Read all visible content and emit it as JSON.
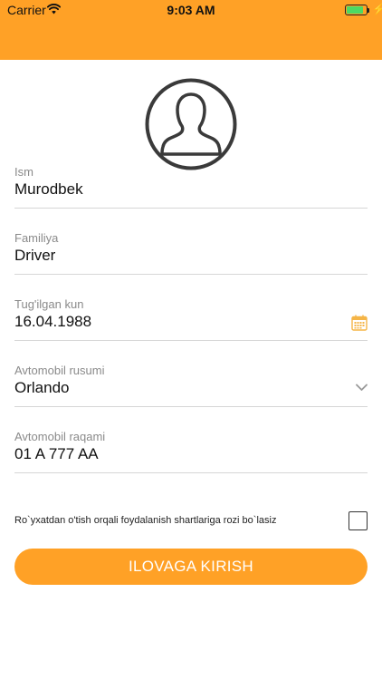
{
  "status_bar": {
    "carrier": "Carrier",
    "time": "9:03 AM",
    "battery_level": 0.9,
    "color": "#FFA126"
  },
  "avatar": {
    "icon": "user-silhouette-icon"
  },
  "form": {
    "first_name": {
      "label": "Ism",
      "value": "Murodbek"
    },
    "last_name": {
      "label": "Familiya",
      "value": "Driver"
    },
    "birth_date": {
      "label": "Tug'ilgan kun",
      "value": "16.04.1988",
      "icon": "calendar-icon"
    },
    "car_model": {
      "label": "Avtomobil rusumi",
      "value": "Orlando",
      "icon": "chevron-down-icon"
    },
    "car_number": {
      "label": "Avtomobil raqami",
      "value": "01 A 777 AA"
    }
  },
  "terms": {
    "text": "Ro`yxatdan o'tish orqali foydalanish shartlariga rozi bo`lasiz",
    "checked": false
  },
  "login_button": {
    "label": "ILOVAGA KIRISH",
    "color": "#FFA126"
  }
}
